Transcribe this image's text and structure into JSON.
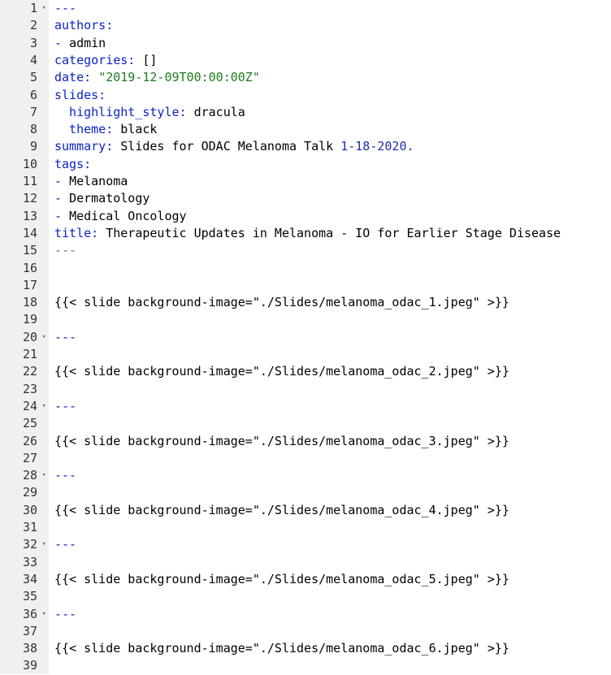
{
  "editor": {
    "lines": [
      {
        "num": "1",
        "fold": true,
        "segments": [
          {
            "t": "---",
            "c": "k"
          }
        ]
      },
      {
        "num": "2",
        "fold": false,
        "segments": [
          {
            "t": "authors:",
            "c": "k"
          }
        ]
      },
      {
        "num": "3",
        "fold": false,
        "segments": [
          {
            "t": "- ",
            "c": "k"
          },
          {
            "t": "admin",
            "c": "p"
          }
        ]
      },
      {
        "num": "4",
        "fold": false,
        "segments": [
          {
            "t": "categories:",
            "c": "k"
          },
          {
            "t": " []",
            "c": "p"
          }
        ]
      },
      {
        "num": "5",
        "fold": false,
        "segments": [
          {
            "t": "date:",
            "c": "k"
          },
          {
            "t": " ",
            "c": "p"
          },
          {
            "t": "\"2019-12-09T00:00:00Z\"",
            "c": "s"
          }
        ]
      },
      {
        "num": "6",
        "fold": false,
        "segments": [
          {
            "t": "slides:",
            "c": "k"
          }
        ]
      },
      {
        "num": "7",
        "fold": false,
        "segments": [
          {
            "t": "  highlight_style:",
            "c": "k"
          },
          {
            "t": " dracula",
            "c": "p"
          }
        ]
      },
      {
        "num": "8",
        "fold": false,
        "segments": [
          {
            "t": "  theme:",
            "c": "k"
          },
          {
            "t": " black",
            "c": "p"
          }
        ]
      },
      {
        "num": "9",
        "fold": false,
        "segments": [
          {
            "t": "summary:",
            "c": "k"
          },
          {
            "t": " Slides for ODAC Melanoma Talk ",
            "c": "p"
          },
          {
            "t": "1-18-2020.",
            "c": "n"
          }
        ]
      },
      {
        "num": "10",
        "fold": false,
        "segments": [
          {
            "t": "tags:",
            "c": "k"
          }
        ]
      },
      {
        "num": "11",
        "fold": false,
        "segments": [
          {
            "t": "- ",
            "c": "k"
          },
          {
            "t": "Melanoma",
            "c": "p"
          }
        ]
      },
      {
        "num": "12",
        "fold": false,
        "segments": [
          {
            "t": "- ",
            "c": "k"
          },
          {
            "t": "Dermatology",
            "c": "p"
          }
        ]
      },
      {
        "num": "13",
        "fold": false,
        "segments": [
          {
            "t": "- ",
            "c": "k"
          },
          {
            "t": "Medical Oncology",
            "c": "p"
          }
        ]
      },
      {
        "num": "14",
        "fold": false,
        "segments": [
          {
            "t": "title:",
            "c": "k"
          },
          {
            "t": " Therapeutic Updates in Melanoma - IO for Earlier Stage Disease",
            "c": "p"
          }
        ]
      },
      {
        "num": "15",
        "fold": false,
        "segments": [
          {
            "t": "---",
            "c": "sh"
          }
        ]
      },
      {
        "num": "16",
        "fold": false,
        "segments": []
      },
      {
        "num": "17",
        "fold": false,
        "segments": []
      },
      {
        "num": "18",
        "fold": false,
        "segments": [
          {
            "t": "{{< slide background-image=\"./Slides/melanoma_odac_1.jpeg\" >}}",
            "c": "p"
          }
        ]
      },
      {
        "num": "19",
        "fold": false,
        "segments": []
      },
      {
        "num": "20",
        "fold": true,
        "segments": [
          {
            "t": "---",
            "c": "k"
          }
        ]
      },
      {
        "num": "21",
        "fold": false,
        "segments": []
      },
      {
        "num": "22",
        "fold": false,
        "segments": [
          {
            "t": "{{< slide background-image=\"./Slides/melanoma_odac_2.jpeg\" >}}",
            "c": "p"
          }
        ]
      },
      {
        "num": "23",
        "fold": false,
        "segments": []
      },
      {
        "num": "24",
        "fold": true,
        "segments": [
          {
            "t": "---",
            "c": "k"
          }
        ]
      },
      {
        "num": "25",
        "fold": false,
        "segments": []
      },
      {
        "num": "26",
        "fold": false,
        "segments": [
          {
            "t": "{{< slide background-image=\"./Slides/melanoma_odac_3.jpeg\" >}}",
            "c": "p"
          }
        ]
      },
      {
        "num": "27",
        "fold": false,
        "segments": []
      },
      {
        "num": "28",
        "fold": true,
        "segments": [
          {
            "t": "---",
            "c": "k"
          }
        ]
      },
      {
        "num": "29",
        "fold": false,
        "segments": []
      },
      {
        "num": "30",
        "fold": false,
        "segments": [
          {
            "t": "{{< slide background-image=\"./Slides/melanoma_odac_4.jpeg\" >}}",
            "c": "p"
          }
        ]
      },
      {
        "num": "31",
        "fold": false,
        "segments": []
      },
      {
        "num": "32",
        "fold": true,
        "segments": [
          {
            "t": "---",
            "c": "k"
          }
        ]
      },
      {
        "num": "33",
        "fold": false,
        "segments": []
      },
      {
        "num": "34",
        "fold": false,
        "segments": [
          {
            "t": "{{< slide background-image=\"./Slides/melanoma_odac_5.jpeg\" >}}",
            "c": "p"
          }
        ]
      },
      {
        "num": "35",
        "fold": false,
        "segments": []
      },
      {
        "num": "36",
        "fold": true,
        "segments": [
          {
            "t": "---",
            "c": "k"
          }
        ]
      },
      {
        "num": "37",
        "fold": false,
        "segments": []
      },
      {
        "num": "38",
        "fold": false,
        "segments": [
          {
            "t": "{{< slide background-image=\"./Slides/melanoma_odac_6.jpeg\" >}}",
            "c": "p"
          }
        ]
      },
      {
        "num": "39",
        "fold": false,
        "segments": []
      }
    ],
    "fold_icon": "fold-arrow-icon",
    "colors": {
      "keyword": "#0b24c5",
      "string": "#1e7a1e",
      "number": "#1c2db5",
      "gutter_bg": "#f0f0f0",
      "text": "#000000"
    }
  }
}
